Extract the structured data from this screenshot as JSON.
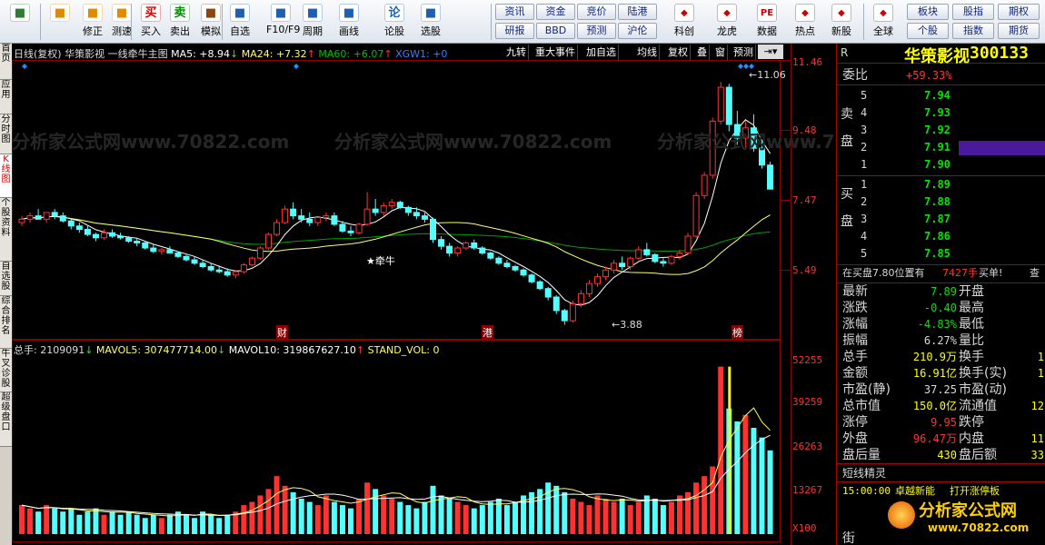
{
  "toolbar": {
    "left_buttons": [
      {
        "label": "",
        "icon": "grid-icon",
        "color": "#2e7d32"
      },
      {
        "label": "",
        "icon": "back-arrow-icon",
        "color": "#e08a00"
      },
      {
        "label": "修正",
        "icon": "up-down-arrows-icon",
        "color": "#e08a00"
      },
      {
        "label": "测速",
        "icon": "speed-clock-icon",
        "color": "#e08a00"
      },
      {
        "label": "买入",
        "icon": "buy-icon",
        "glyph": "买",
        "color": "#d00000"
      },
      {
        "label": "卖出",
        "icon": "sell-icon",
        "glyph": "卖",
        "color": "#008a00"
      },
      {
        "label": "模拟",
        "icon": "hammer-icon",
        "color": "#8b4513"
      },
      {
        "label": "自选",
        "icon": "folder-icon",
        "color": "#1f5fb0"
      },
      {
        "label": "F10/F9",
        "icon": "document-icon",
        "color": "#1f5fb0"
      },
      {
        "label": "周期",
        "icon": "period-chart-icon",
        "color": "#1f5fb0"
      },
      {
        "label": "画线",
        "icon": "pencil-icon",
        "color": "#1f5fb0"
      },
      {
        "label": "论股",
        "icon": "discussion-icon",
        "glyph": "论",
        "color": "#1f5fb0"
      },
      {
        "label": "选股",
        "icon": "stock-picker-icon",
        "color": "#1f5fb0"
      }
    ],
    "grid_buttons": [
      "资讯",
      "资金",
      "竞价",
      "陆港",
      "研报",
      "BBD",
      "预测",
      "沪伦"
    ],
    "right_buttons": [
      {
        "label": "科创",
        "icon": "kechuang-icon"
      },
      {
        "label": "龙虎",
        "icon": "dragon-tiger-icon"
      },
      {
        "label": "数据",
        "icon": "pe-data-icon",
        "glyph": "PE"
      },
      {
        "label": "热点",
        "icon": "hot-fire-icon"
      },
      {
        "label": "新股",
        "icon": "new-stock-icon"
      },
      {
        "label": "全球",
        "icon": "globe-icon"
      }
    ],
    "board_buttons": [
      "板块",
      "股指",
      "期权",
      "个股",
      "指数",
      "期货"
    ]
  },
  "left_tabs": [
    "首页",
    "应用",
    "分时图",
    "K线图",
    "个股资料",
    "自选股",
    "综合排名",
    "牛叉诊股",
    "超级盘口"
  ],
  "chart_header": {
    "mode": "日线(复权)",
    "name": "华策影视",
    "indicator": "一线牵牛主图",
    "ma5": "MA5: +8.94",
    "ma24": "MA24: +7.32",
    "ma60": "MA60: +6.07",
    "xgw": "XGW1: +0"
  },
  "chart_chips": [
    "九转",
    "重大事件",
    "加自选",
    "均线",
    "复权",
    "叠",
    "窗",
    "预测"
  ],
  "price_axis": [
    "11.46",
    "9.48",
    "7.47",
    "5.49"
  ],
  "volume_axis": [
    "52255",
    "39259",
    "26263",
    "13267",
    "X100"
  ],
  "volume_header": {
    "total": "总手: 2109091",
    "mavol5": "MAVOL5: 307477714.00",
    "mavol10": "MAVOL10: 319867627.10",
    "stand": "STAND_VOL: 0"
  },
  "annotations": {
    "high": "11.06",
    "low": "3.88",
    "signal": "★牵牛",
    "mark_cai": "财",
    "mark_gang": "港",
    "mark_bang": "榜"
  },
  "watermark": "分析家公式网www.70822.com",
  "colors": {
    "up": "#ff3232",
    "down": "#54ffff",
    "ma5": "#ffffff",
    "ma24": "#ffff66",
    "ma60": "#00a000",
    "accent": "#ffff00"
  },
  "chart_data": {
    "type": "candlestick",
    "candles": [
      [
        6.9,
        7.1,
        6.8,
        7.0
      ],
      [
        7.0,
        7.2,
        6.9,
        7.1
      ],
      [
        7.1,
        7.3,
        7.0,
        7.0
      ],
      [
        7.0,
        7.2,
        6.9,
        7.2
      ],
      [
        7.2,
        7.3,
        7.0,
        7.1
      ],
      [
        7.1,
        7.2,
        6.9,
        6.95
      ],
      [
        6.95,
        7.0,
        6.7,
        6.8
      ],
      [
        6.8,
        6.9,
        6.6,
        6.7
      ],
      [
        6.7,
        6.8,
        6.5,
        6.55
      ],
      [
        6.55,
        6.6,
        6.35,
        6.45
      ],
      [
        6.45,
        6.7,
        6.4,
        6.6
      ],
      [
        6.6,
        6.7,
        6.45,
        6.5
      ],
      [
        6.5,
        6.6,
        6.4,
        6.45
      ],
      [
        6.45,
        6.5,
        6.3,
        6.35
      ],
      [
        6.35,
        6.45,
        6.2,
        6.3
      ],
      [
        6.3,
        6.35,
        6.1,
        6.15
      ],
      [
        6.15,
        6.25,
        6.0,
        6.05
      ],
      [
        6.05,
        6.15,
        5.95,
        6.1
      ],
      [
        6.1,
        6.2,
        6.0,
        6.0
      ],
      [
        6.0,
        6.05,
        5.85,
        5.9
      ],
      [
        5.9,
        5.95,
        5.75,
        5.8
      ],
      [
        5.8,
        5.9,
        5.65,
        5.7
      ],
      [
        5.7,
        5.8,
        5.55,
        5.6
      ],
      [
        5.6,
        5.7,
        5.45,
        5.5
      ],
      [
        5.5,
        5.6,
        5.4,
        5.45
      ],
      [
        5.45,
        5.55,
        5.3,
        5.35
      ],
      [
        5.35,
        5.5,
        5.25,
        5.45
      ],
      [
        5.45,
        5.7,
        5.4,
        5.65
      ],
      [
        5.65,
        5.9,
        5.6,
        5.85
      ],
      [
        5.85,
        6.2,
        5.8,
        6.15
      ],
      [
        6.15,
        6.6,
        6.1,
        6.55
      ],
      [
        6.55,
        7.0,
        6.5,
        6.9
      ],
      [
        6.9,
        7.4,
        6.85,
        7.3
      ],
      [
        7.3,
        7.5,
        7.0,
        7.1
      ],
      [
        7.1,
        7.3,
        6.9,
        7.0
      ],
      [
        7.0,
        7.2,
        6.8,
        6.9
      ],
      [
        6.9,
        7.1,
        6.8,
        7.05
      ],
      [
        7.05,
        7.2,
        6.95,
        7.1
      ],
      [
        7.1,
        7.2,
        6.8,
        6.85
      ],
      [
        6.85,
        6.95,
        6.6,
        6.65
      ],
      [
        6.65,
        6.8,
        6.5,
        6.6
      ],
      [
        6.6,
        6.9,
        6.55,
        6.85
      ],
      [
        6.85,
        7.8,
        6.8,
        7.3
      ],
      [
        7.3,
        7.6,
        7.1,
        7.2
      ],
      [
        7.2,
        7.5,
        7.1,
        7.4
      ],
      [
        7.4,
        7.6,
        7.3,
        7.5
      ],
      [
        7.5,
        7.55,
        7.3,
        7.35
      ],
      [
        7.35,
        7.4,
        7.1,
        7.2
      ],
      [
        7.2,
        7.35,
        7.0,
        7.1
      ],
      [
        7.1,
        7.2,
        6.9,
        7.0
      ],
      [
        7.0,
        7.05,
        6.3,
        6.4
      ],
      [
        6.4,
        6.5,
        6.1,
        6.2
      ],
      [
        6.2,
        6.3,
        5.9,
        6.0
      ],
      [
        6.0,
        6.2,
        5.9,
        6.15
      ],
      [
        6.15,
        6.35,
        6.1,
        6.3
      ],
      [
        6.3,
        6.4,
        6.1,
        6.15
      ],
      [
        6.15,
        6.2,
        5.95,
        6.0
      ],
      [
        6.0,
        6.05,
        5.8,
        5.85
      ],
      [
        5.85,
        5.9,
        5.65,
        5.7
      ],
      [
        5.7,
        5.8,
        5.55,
        5.6
      ],
      [
        5.6,
        5.65,
        5.45,
        5.5
      ],
      [
        5.5,
        5.55,
        5.3,
        5.35
      ],
      [
        5.35,
        5.4,
        5.1,
        5.15
      ],
      [
        5.15,
        5.2,
        4.9,
        4.95
      ],
      [
        4.95,
        5.0,
        4.6,
        4.7
      ],
      [
        4.7,
        4.75,
        4.2,
        4.3
      ],
      [
        4.3,
        4.35,
        3.88,
        4.0
      ],
      [
        4.0,
        4.6,
        3.95,
        4.5
      ],
      [
        4.5,
        4.9,
        4.4,
        4.8
      ],
      [
        4.8,
        5.2,
        4.7,
        5.1
      ],
      [
        5.1,
        5.4,
        5.0,
        5.3
      ],
      [
        5.3,
        5.6,
        5.2,
        5.5
      ],
      [
        5.5,
        5.8,
        5.4,
        5.7
      ],
      [
        5.7,
        5.9,
        5.5,
        5.6
      ],
      [
        5.6,
        5.9,
        5.5,
        5.85
      ],
      [
        5.85,
        6.2,
        5.8,
        6.1
      ],
      [
        6.1,
        6.3,
        5.9,
        5.95
      ],
      [
        5.95,
        6.0,
        5.7,
        5.75
      ],
      [
        5.75,
        5.85,
        5.6,
        5.7
      ],
      [
        5.7,
        5.95,
        5.65,
        5.9
      ],
      [
        5.9,
        6.1,
        5.8,
        6.0
      ],
      [
        6.0,
        6.6,
        5.95,
        6.5
      ],
      [
        6.5,
        7.8,
        6.45,
        7.7
      ],
      [
        7.7,
        8.4,
        7.6,
        8.3
      ],
      [
        8.3,
        10.0,
        8.2,
        9.9
      ],
      [
        9.9,
        11.06,
        9.8,
        10.9
      ],
      [
        10.9,
        11.0,
        9.6,
        9.8
      ],
      [
        9.8,
        10.2,
        9.2,
        9.4
      ],
      [
        9.4,
        9.9,
        9.1,
        9.7
      ],
      [
        9.7,
        10.1,
        9.0,
        9.1
      ],
      [
        9.1,
        9.3,
        8.5,
        8.6
      ],
      [
        8.6,
        8.7,
        8.0,
        7.89
      ]
    ],
    "volume": [
      9,
      8,
      7,
      9,
      8,
      7,
      8,
      6,
      7,
      8,
      6,
      7,
      6,
      7,
      6,
      5,
      6,
      5,
      6,
      7,
      6,
      5,
      7,
      6,
      5,
      6,
      7,
      9,
      10,
      12,
      14,
      18,
      15,
      13,
      11,
      10,
      9,
      12,
      10,
      9,
      8,
      11,
      16,
      14,
      12,
      11,
      10,
      9,
      8,
      10,
      15,
      12,
      11,
      10,
      9,
      8,
      9,
      10,
      11,
      9,
      10,
      12,
      13,
      14,
      16,
      15,
      13,
      11,
      10,
      9,
      12,
      11,
      10,
      11,
      9,
      10,
      12,
      11,
      9,
      10,
      12,
      13,
      16,
      18,
      21,
      52,
      39,
      35,
      37,
      33,
      30,
      26
    ],
    "ymin": 3.6,
    "ymax": 11.6
  },
  "quote": {
    "title": "华策影视",
    "code": "300133",
    "r": "R",
    "weibi_label": "委比",
    "weibi": "+59.33%",
    "sell_label": "卖盘",
    "buy_label": "买盘",
    "asks": [
      {
        "lv": "5",
        "price": "7.94",
        "vol": ""
      },
      {
        "lv": "4",
        "price": "7.93",
        "vol": ""
      },
      {
        "lv": "3",
        "price": "7.92",
        "vol": ""
      },
      {
        "lv": "2",
        "price": "7.91",
        "vol": ""
      },
      {
        "lv": "1",
        "price": "7.90",
        "vol": ""
      }
    ],
    "bids": [
      {
        "lv": "1",
        "price": "7.89",
        "vol": ""
      },
      {
        "lv": "2",
        "price": "7.88",
        "vol": ""
      },
      {
        "lv": "3",
        "price": "7.87",
        "vol": ""
      },
      {
        "lv": "4",
        "price": "7.86",
        "vol": ""
      },
      {
        "lv": "5",
        "price": "7.85",
        "vol": ""
      }
    ],
    "buy_order_text": "在买盘7.80位置有",
    "buy_order_vol": "7427手",
    "buy_order_tag": "买单!",
    "buy_order_more": "查",
    "stats": [
      {
        "l": "最新",
        "v": "7.89",
        "vc": "c-g",
        "l2": "开盘",
        "v2": ""
      },
      {
        "l": "涨跌",
        "v": "-0.40",
        "vc": "c-g",
        "l2": "最高",
        "v2": ""
      },
      {
        "l": "涨幅",
        "v": "-4.83%",
        "vc": "c-g",
        "l2": "最低",
        "v2": ""
      },
      {
        "l": "振幅",
        "v": "6.27%",
        "vc": "c-w",
        "l2": "量比",
        "v2": ""
      },
      {
        "l": "总手",
        "v": "210.9万",
        "vc": "c-y",
        "l2": "换手",
        "v2": "1"
      },
      {
        "l": "金额",
        "v": "16.91亿",
        "vc": "c-y",
        "l2": "换手(实)",
        "v2": "1"
      },
      {
        "l": "市盈(静)",
        "v": "37.25",
        "vc": "c-w",
        "l2": "市盈(动)",
        "v2": ""
      },
      {
        "l": "总市值",
        "v": "150.0亿",
        "vc": "c-y",
        "l2": "流通值",
        "v2": "12"
      },
      {
        "l": "涨停",
        "v": "9.95",
        "vc": "c-r",
        "l2": "跌停",
        "v2": ""
      },
      {
        "l": "外盘",
        "v": "96.47万",
        "vc": "c-r",
        "l2": "内盘",
        "v2": "11"
      },
      {
        "l": "盘后量",
        "v": "430",
        "vc": "c-y",
        "l2": "盘后额",
        "v2": "33"
      }
    ],
    "news_title": "短线精灵",
    "news": [
      {
        "time": "15:00:00",
        "text": "卓越新能",
        "tag": "打开涨停板"
      }
    ],
    "footer_tab": "街",
    "logo_text": "分析家公式网",
    "logo_url": "www.70822.com"
  }
}
